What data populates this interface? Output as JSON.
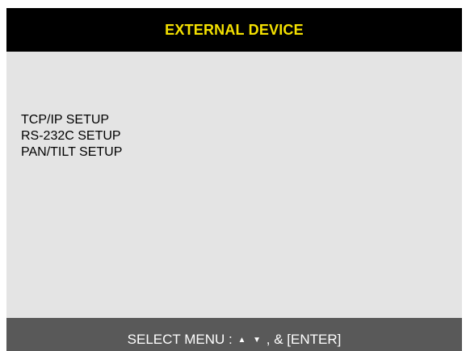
{
  "header": {
    "title": "EXTERNAL DEVICE"
  },
  "menu": {
    "items": [
      {
        "label": "TCP/IP SETUP"
      },
      {
        "label": "RS-232C SETUP"
      },
      {
        "label": "PAN/TILT SETUP"
      }
    ]
  },
  "footer": {
    "prefix": "SELECT MENU :",
    "up_arrow": "▲",
    "down_arrow": "▼",
    "suffix": ", & [ENTER]"
  },
  "colors": {
    "title_bar": "#000000",
    "title_text": "#f5e100",
    "panel": "#e4e4e4",
    "footer_bar": "#595959",
    "footer_text": "#ffffff"
  }
}
